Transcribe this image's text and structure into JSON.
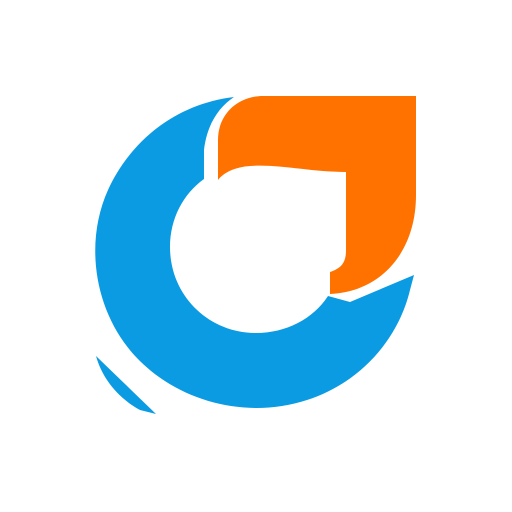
{
  "logo": {
    "name": "logo-mark",
    "colors": {
      "background": "#ffffff",
      "blue": "#0b9be3",
      "orange": "#ff7200"
    },
    "icon": "ring-and-drop-logo-icon"
  }
}
